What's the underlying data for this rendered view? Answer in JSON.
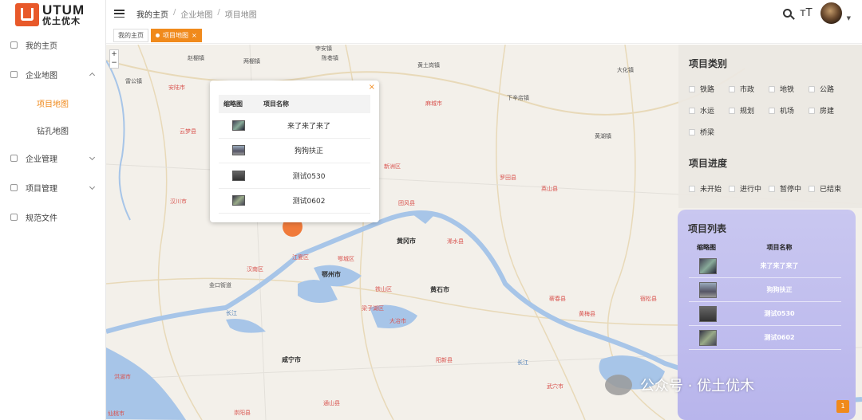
{
  "brand": {
    "logo_en": "UTUM",
    "logo_cn": "优土优木"
  },
  "sidebar": {
    "items": [
      {
        "label": "我的主页",
        "icon": "user-icon"
      },
      {
        "label": "企业地图",
        "icon": "map-icon",
        "expanded": true,
        "children": [
          {
            "label": "项目地图",
            "active": true
          },
          {
            "label": "钻孔地图"
          }
        ]
      },
      {
        "label": "企业管理",
        "icon": "building-icon"
      },
      {
        "label": "项目管理",
        "icon": "folder-icon"
      },
      {
        "label": "规范文件",
        "icon": "document-icon"
      }
    ]
  },
  "breadcrumb": [
    "我的主页",
    "企业地图",
    "项目地图"
  ],
  "topbar": {
    "font_tool": "тT"
  },
  "tabs": [
    {
      "label": "我的主页"
    },
    {
      "label": "项目地图",
      "active": true
    }
  ],
  "map": {
    "zoom": {
      "in": "+",
      "out": "−"
    },
    "labels": [
      {
        "t": "赵棚镇"
      },
      {
        "t": "两棚镇"
      },
      {
        "t": "安陆市",
        "k": "county"
      },
      {
        "t": "陈巷镇"
      },
      {
        "t": "雷公镇"
      },
      {
        "t": "孛安镇"
      },
      {
        "t": "黄土岗镇"
      },
      {
        "t": "大化镇"
      },
      {
        "t": "麻城市",
        "k": "county"
      },
      {
        "t": "云梦县",
        "k": "county"
      },
      {
        "t": "新洲区",
        "k": "county"
      },
      {
        "t": "罗田县",
        "k": "county"
      },
      {
        "t": "汉川市",
        "k": "county"
      },
      {
        "t": "团风县",
        "k": "county"
      },
      {
        "t": "浠水县",
        "k": "county"
      },
      {
        "t": "黄冈市",
        "k": "city"
      },
      {
        "t": "江夏区",
        "k": "county"
      },
      {
        "t": "鄂州市",
        "k": "city"
      },
      {
        "t": "黄石市",
        "k": "city"
      },
      {
        "t": "大冶市",
        "k": "county"
      },
      {
        "t": "梁子湖区",
        "k": "county"
      },
      {
        "t": "汉南区",
        "k": "county"
      },
      {
        "t": "咸宁市",
        "k": "city"
      },
      {
        "t": "阳新县",
        "k": "county"
      },
      {
        "t": "武穴市",
        "k": "county"
      },
      {
        "t": "黄梅县",
        "k": "county"
      },
      {
        "t": "宿松县",
        "k": "county"
      },
      {
        "t": "通山县",
        "k": "county"
      },
      {
        "t": "崇阳县",
        "k": "county"
      },
      {
        "t": "蕲春县",
        "k": "county"
      },
      {
        "t": "英山县",
        "k": "county"
      },
      {
        "t": "长江"
      },
      {
        "t": "洪湖市",
        "k": "county"
      },
      {
        "t": "金口街道"
      },
      {
        "t": "铁山区",
        "k": "county"
      },
      {
        "t": "下辛店镇"
      },
      {
        "t": "黄湖镇"
      },
      {
        "t": "长江"
      },
      {
        "t": "鄂城区",
        "k": "county"
      },
      {
        "t": "仙桃市",
        "k": "county"
      }
    ]
  },
  "popup": {
    "close": "×",
    "headers": [
      "缩略图",
      "项目名称"
    ],
    "rows": [
      {
        "name": "来了来了来了"
      },
      {
        "name": "狗狗扶正"
      },
      {
        "name": "测试0530"
      },
      {
        "name": "测试0602"
      }
    ]
  },
  "category_panel": {
    "title": "项目类别",
    "options": [
      "铁路",
      "市政",
      "地铁",
      "公路",
      "水运",
      "规划",
      "机场",
      "房建",
      "桥梁"
    ]
  },
  "progress_panel": {
    "title": "项目进度",
    "options": [
      "未开始",
      "进行中",
      "暂停中",
      "已结束"
    ]
  },
  "list_panel": {
    "title": "项目列表",
    "headers": [
      "缩略图",
      "项目名称"
    ],
    "rows": [
      {
        "name": "来了来了来了"
      },
      {
        "name": "狗狗扶正"
      },
      {
        "name": "测试0530"
      },
      {
        "name": "测试0602"
      }
    ]
  },
  "watermark": "公众号 · 优土优木",
  "badge": "1",
  "colors": {
    "accent": "#f08a1c",
    "pin": "#f07a3a",
    "list_panel": "#c9c7f0",
    "water": "#a7c5e8",
    "red_label": "#d9534f"
  }
}
